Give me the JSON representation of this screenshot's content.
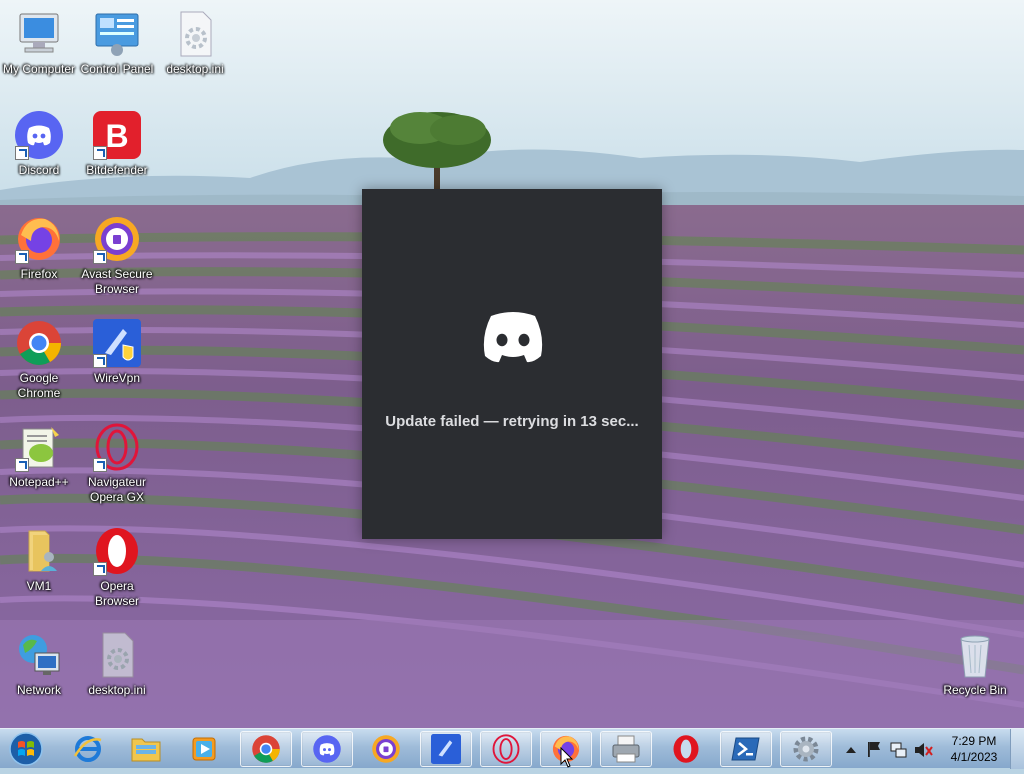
{
  "desktop": {
    "icons": [
      {
        "label": "My Computer"
      },
      {
        "label": "Control Panel"
      },
      {
        "label": "desktop.ini"
      },
      {
        "label": "Discord"
      },
      {
        "label": "Bitdefender"
      },
      {
        "label": "Firefox"
      },
      {
        "label": "Avast Secure\nBrowser"
      },
      {
        "label": "Google\nChrome"
      },
      {
        "label": "WireVpn"
      },
      {
        "label": "Notepad++"
      },
      {
        "label": "Navigateur\nOpera GX"
      },
      {
        "label": "VM1"
      },
      {
        "label": "Opera\nBrowser"
      },
      {
        "label": "Network"
      },
      {
        "label": "desktop.ini"
      },
      {
        "label": "Recycle Bin"
      }
    ]
  },
  "updater": {
    "message": "Update failed — retrying in 13 sec..."
  },
  "taskbar": {
    "clock_time": "7:29 PM",
    "clock_date": "4/1/2023"
  },
  "colors": {
    "discord_blurple": "#5865f2",
    "updater_bg": "#2b2d31",
    "updater_text": "#dcdde0"
  }
}
